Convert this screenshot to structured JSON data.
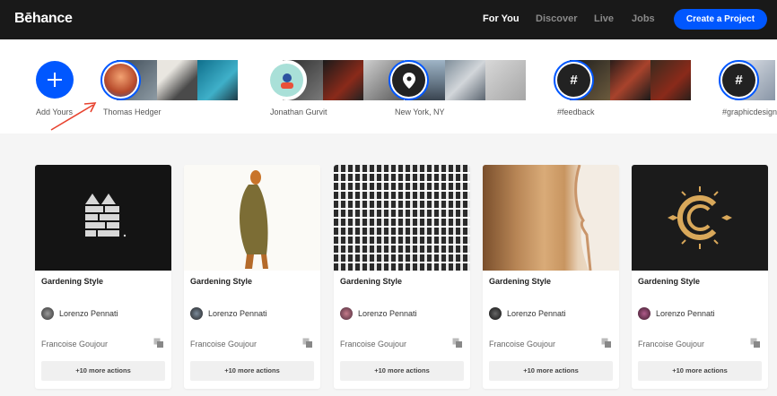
{
  "header": {
    "logo": "Bēhance",
    "nav": [
      "For You",
      "Discover",
      "Live",
      "Jobs"
    ],
    "create_label": "Create a Project"
  },
  "stories": {
    "add_label": "Add Yours",
    "items": [
      {
        "label": "Thomas Hedger",
        "avatar_icon": "user-avatar"
      },
      {
        "label": "Jonathan Gurvit",
        "avatar_icon": "user-avatar"
      },
      {
        "label": "New York, NY",
        "avatar_icon": "location-pin-icon"
      },
      {
        "label": "#feedback",
        "avatar_icon": "hashtag-icon"
      },
      {
        "label": "#graphicdesign",
        "avatar_icon": "hashtag-icon"
      }
    ]
  },
  "cards": [
    {
      "title": "Gardening Style",
      "owner": "Lorenzo Pennati",
      "subowner": "Francoise Goujour",
      "more": "+10 more actions"
    },
    {
      "title": "Gardening Style",
      "owner": "Lorenzo Pennati",
      "subowner": "Francoise Goujour",
      "more": "+10 more actions"
    },
    {
      "title": "Gardening Style",
      "owner": "Lorenzo Pennati",
      "subowner": "Francoise Goujour",
      "more": "+10 more actions"
    },
    {
      "title": "Gardening Style",
      "owner": "Lorenzo Pennati",
      "subowner": "Francoise Goujour",
      "more": "+10 more actions"
    },
    {
      "title": "Gardening Style",
      "owner": "Lorenzo Pennati",
      "subowner": "Francoise Goujour",
      "more": "+10 more actions"
    }
  ],
  "colors": {
    "accent": "#0057ff",
    "header_bg": "#191919",
    "arrow": "#e8432f"
  }
}
